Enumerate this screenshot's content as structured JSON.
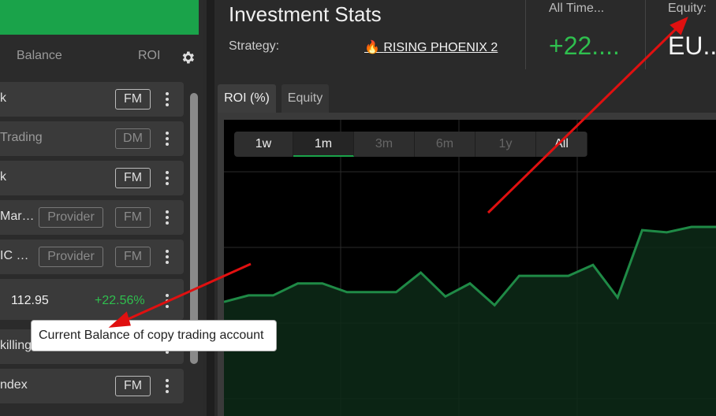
{
  "left_panel": {
    "col_balance": "Balance",
    "col_roi": "ROI",
    "rows": [
      {
        "name": "k",
        "name_dim": false,
        "badge1": "",
        "badge2": "FM",
        "badge2_dim": false,
        "balance": "",
        "roi": ""
      },
      {
        "name": "Trading",
        "name_dim": true,
        "badge1": "",
        "badge2": "DM",
        "badge2_dim": true,
        "balance": "",
        "roi": ""
      },
      {
        "name": "k",
        "name_dim": false,
        "badge1": "",
        "badge2": "FM",
        "badge2_dim": false,
        "balance": "",
        "roi": ""
      },
      {
        "name": "Mar…",
        "name_dim": false,
        "badge1": "Provider",
        "badge2": "FM",
        "badge2_dim": true,
        "balance": "",
        "roi": ""
      },
      {
        "name": "IC …",
        "name_dim": false,
        "badge1": "Provider",
        "badge2": "FM",
        "badge2_dim": true,
        "balance": "",
        "roi": ""
      },
      {
        "name": "",
        "name_dim": false,
        "badge1": "",
        "badge2": "",
        "badge2_dim": false,
        "balance": "112.95",
        "roi": "+22.56%"
      },
      {
        "name": "killing",
        "name_dim": false,
        "badge1": "",
        "badge2": "",
        "badge2_dim": false,
        "balance": "",
        "roi": ""
      },
      {
        "name": "ndex",
        "name_dim": false,
        "badge1": "",
        "badge2": "FM",
        "badge2_dim": false,
        "balance": "",
        "roi": ""
      }
    ]
  },
  "header": {
    "title": "Investment Stats",
    "strategy_label": "Strategy:",
    "strategy_icon": "🔥",
    "strategy_name": "RISING PHOENIX 2",
    "all_time_label": "All Time...",
    "all_time_value": "+22....",
    "equity_label": "Equity:",
    "equity_value": "EU..."
  },
  "tabs": [
    {
      "label": "ROI (%)",
      "active": true
    },
    {
      "label": "Equity",
      "active": false
    }
  ],
  "range_buttons": [
    {
      "label": "1w",
      "enabled": true,
      "selected": false
    },
    {
      "label": "1m",
      "enabled": true,
      "selected": true
    },
    {
      "label": "3m",
      "enabled": false,
      "selected": false
    },
    {
      "label": "6m",
      "enabled": false,
      "selected": false
    },
    {
      "label": "1y",
      "enabled": false,
      "selected": false
    },
    {
      "label": "All",
      "enabled": true,
      "selected": false
    }
  ],
  "tooltip": "Current Balance of copy trading account",
  "colors": {
    "accent_green": "#1aa34a",
    "positive": "#2fbf4e",
    "annotation_arrow": "#e01010"
  },
  "chart_data": {
    "type": "area",
    "values": [
      0.1,
      0.16,
      0.16,
      0.27,
      0.27,
      0.19,
      0.19,
      0.19,
      0.37,
      0.15,
      0.27,
      0.07,
      0.34,
      0.34,
      0.34,
      0.44,
      0.14,
      0.76,
      0.74,
      0.79,
      0.79
    ],
    "grid": true
  }
}
